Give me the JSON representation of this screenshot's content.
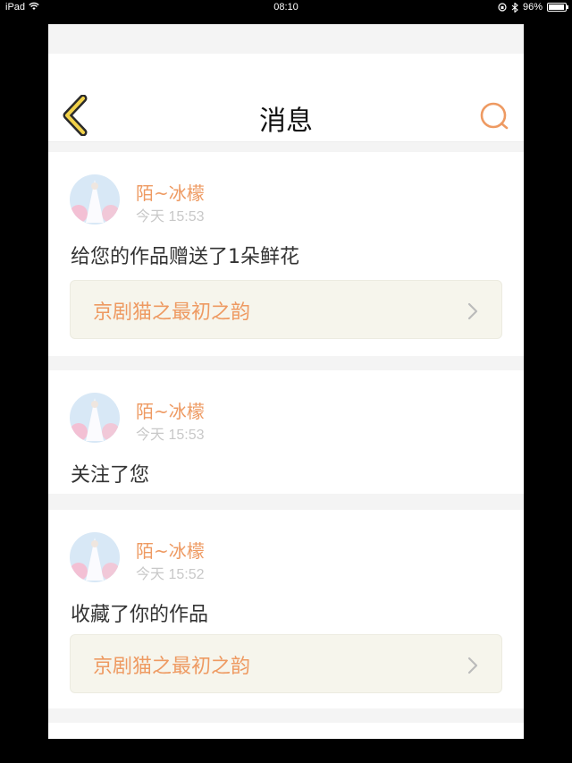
{
  "status_bar": {
    "device": "iPad",
    "time": "08:10",
    "battery": "96%"
  },
  "nav": {
    "title": "消息",
    "back_icon": "chevron-left-icon",
    "search_icon": "search-icon"
  },
  "notifications": [
    {
      "username": "陌~冰檬",
      "time": "今天 15:53",
      "message": "给您的作品赠送了1朵鲜花",
      "work_title": "京剧猫之最初之韵"
    },
    {
      "username": "陌~冰檬",
      "time": "今天 15:53",
      "message": "关注了您"
    },
    {
      "username": "陌~冰檬",
      "time": "今天 15:52",
      "message": "收藏了你的作品",
      "work_title": "京剧猫之最初之韵"
    }
  ],
  "colors": {
    "accent": "#ee9a62",
    "back_icon_fill": "#f2d24a",
    "link_bg": "#f6f5ec"
  }
}
